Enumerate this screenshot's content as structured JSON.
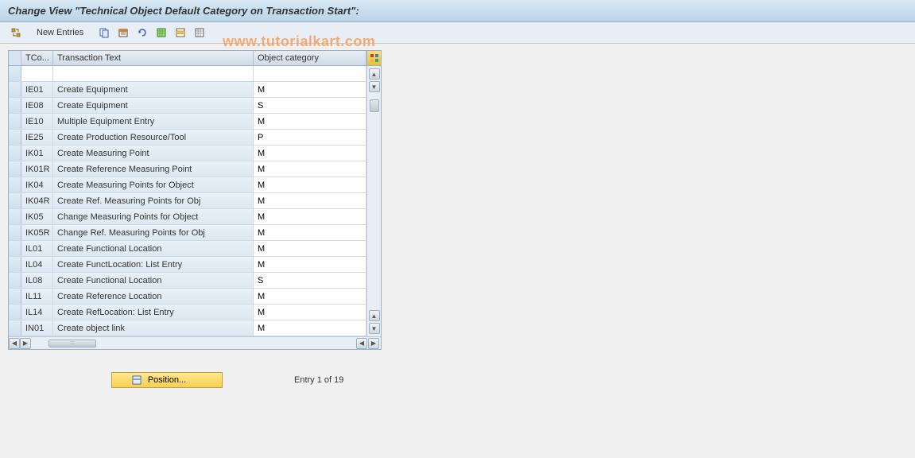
{
  "title": "Change View \"Technical Object Default Category on Transaction Start\":",
  "toolbar": {
    "new_entries_label": "New Entries"
  },
  "watermark": "www.tutorialkart.com",
  "table": {
    "headers": {
      "tcode": "TCo...",
      "text": "Transaction Text",
      "category": "Object category"
    },
    "rows": [
      {
        "tcode": "IE01",
        "text": "Create Equipment",
        "category": "M"
      },
      {
        "tcode": "IE08",
        "text": "Create Equipment",
        "category": "S"
      },
      {
        "tcode": "IE10",
        "text": "Multiple Equipment Entry",
        "category": "M"
      },
      {
        "tcode": "IE25",
        "text": "Create Production Resource/Tool",
        "category": "P"
      },
      {
        "tcode": "IK01",
        "text": "Create Measuring Point",
        "category": "M"
      },
      {
        "tcode": "IK01R",
        "text": "Create Reference Measuring Point",
        "category": "M"
      },
      {
        "tcode": "IK04",
        "text": "Create Measuring Points for Object",
        "category": "M"
      },
      {
        "tcode": "IK04R",
        "text": "Create Ref. Measuring Points for Obj",
        "category": "M"
      },
      {
        "tcode": "IK05",
        "text": "Change Measuring Points for Object",
        "category": "M"
      },
      {
        "tcode": "IK05R",
        "text": "Change Ref. Measuring Points for Obj",
        "category": "M"
      },
      {
        "tcode": "IL01",
        "text": "Create Functional Location",
        "category": "M"
      },
      {
        "tcode": "IL04",
        "text": "Create FunctLocation: List Entry",
        "category": "M"
      },
      {
        "tcode": "IL08",
        "text": "Create Functional Location",
        "category": "S"
      },
      {
        "tcode": "IL11",
        "text": "Create Reference Location",
        "category": "M"
      },
      {
        "tcode": "IL14",
        "text": "Create RefLocation: List Entry",
        "category": "M"
      },
      {
        "tcode": "IN01",
        "text": "Create object link",
        "category": "M"
      }
    ]
  },
  "footer": {
    "position_label": "Position...",
    "entry_status": "Entry 1 of 19"
  }
}
